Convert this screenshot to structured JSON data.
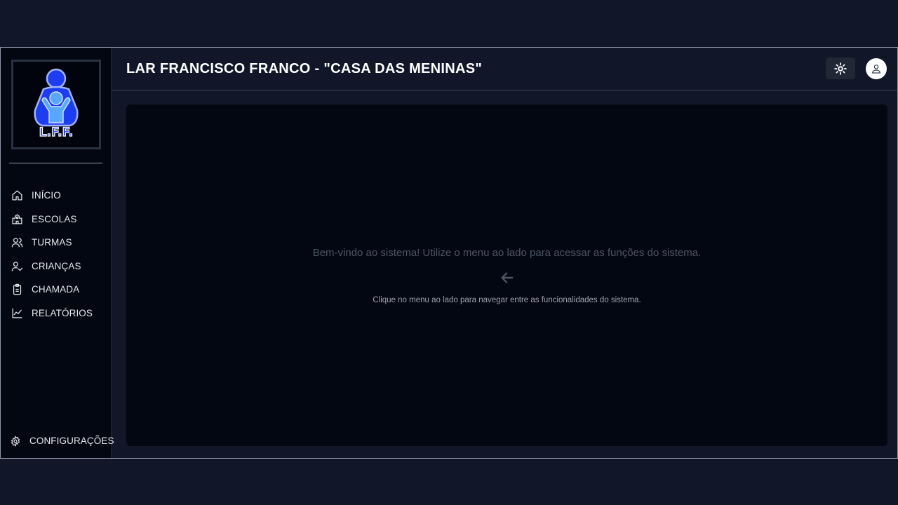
{
  "logo": {
    "text": "L.F.F."
  },
  "sidebar": {
    "items": [
      {
        "label": "INÍCIO",
        "icon": "home-icon"
      },
      {
        "label": "ESCOLAS",
        "icon": "school-icon"
      },
      {
        "label": "TURMAS",
        "icon": "users-icon"
      },
      {
        "label": "CRIANÇAS",
        "icon": "user-check-icon"
      },
      {
        "label": "CHAMADA",
        "icon": "clipboard-icon"
      },
      {
        "label": "RELATÓRIOS",
        "icon": "chart-line-icon"
      }
    ],
    "settings": {
      "label": "CONFIGURAÇÕES",
      "icon": "gear-icon"
    }
  },
  "header": {
    "title": "LAR FRANCISCO FRANCO - \"CASA DAS MENINAS\"",
    "theme_toggle_icon": "sun-icon",
    "avatar_icon": "user-icon"
  },
  "main": {
    "welcome": "Bem-vindo ao sistema! Utilize o menu ao lado para acessar as funções do sistema.",
    "arrow_icon": "arrow-left-icon",
    "hint": "Clique no menu ao lado para navegar entre as funcionalidades do sistema."
  },
  "colors": {
    "page_bg": "#111729",
    "sidebar_bg": "#030712",
    "card_bg": "#030712",
    "logo_blue": "#1d3df5"
  }
}
